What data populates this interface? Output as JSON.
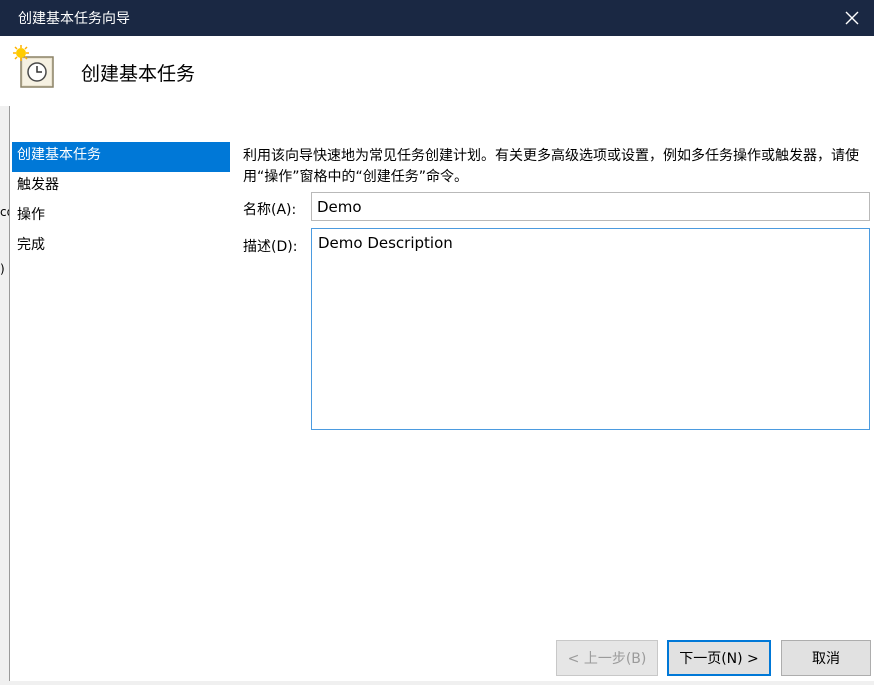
{
  "window": {
    "title": "创建基本任务向导",
    "close_glyph": "✕"
  },
  "header": {
    "icon": "task-clock-icon",
    "heading": "创建基本任务"
  },
  "background_window": {
    "stub_1": "cd",
    "stub_2": ")"
  },
  "nav": {
    "items": [
      {
        "label": "创建基本任务",
        "active": true
      },
      {
        "label": "触发器",
        "active": false
      },
      {
        "label": "操作",
        "active": false
      },
      {
        "label": "完成",
        "active": false
      }
    ]
  },
  "main": {
    "description": "利用该向导快速地为常见任务创建计划。有关更多高级选项或设置，例如多任务操作或触发器，请使用“操作”窗格中的“创建任务”命令。",
    "name_label": "名称(A):",
    "name_value": "Demo",
    "desc_label": "描述(D):",
    "desc_value": "Demo Description"
  },
  "buttons": {
    "back": "< 上一步(B)",
    "next": "下一页(N) >",
    "cancel": "取消"
  },
  "colors": {
    "titlebar": "#1a2843",
    "accent": "#0078d7"
  }
}
